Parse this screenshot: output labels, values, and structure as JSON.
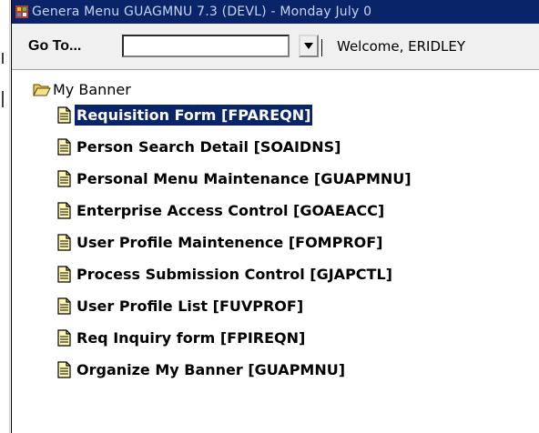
{
  "window": {
    "title": "Genera Menu GUAGMNU 7.3 (DEVL) - Monday July 0"
  },
  "toolbar": {
    "goto_label": "Go To...",
    "goto_value": "",
    "welcome_text": "Welcome, ERIDLEY"
  },
  "tree": {
    "root_label": "My Banner",
    "items": [
      {
        "label": "Requisition Form [FPAREQN]",
        "icon": "document-icon",
        "selected": true
      },
      {
        "label": "Person Search Detail [SOAIDNS]",
        "icon": "document-icon",
        "selected": false
      },
      {
        "label": "Personal Menu Maintenance [GUAPMNU]",
        "icon": "document-icon",
        "selected": false
      },
      {
        "label": "Enterprise Access Control [GOAEACC]",
        "icon": "document-icon",
        "selected": false
      },
      {
        "label": "User Profile Maintenence [FOMPROF]",
        "icon": "document-icon",
        "selected": false
      },
      {
        "label": "Process Submission Control [GJAPCTL]",
        "icon": "document-icon",
        "selected": false
      },
      {
        "label": "User Profile List [FUVPROF]",
        "icon": "document-icon",
        "selected": false
      },
      {
        "label": "Req Inquiry form [FPIREQN]",
        "icon": "document-icon",
        "selected": false
      },
      {
        "label": "Organize My Banner [GUAPMNU]",
        "icon": "document-icon",
        "selected": false
      }
    ]
  },
  "colors": {
    "selection": "#0a246a",
    "titlebar": "#0a246a",
    "toolbar_bg": "#f0f0f0"
  }
}
